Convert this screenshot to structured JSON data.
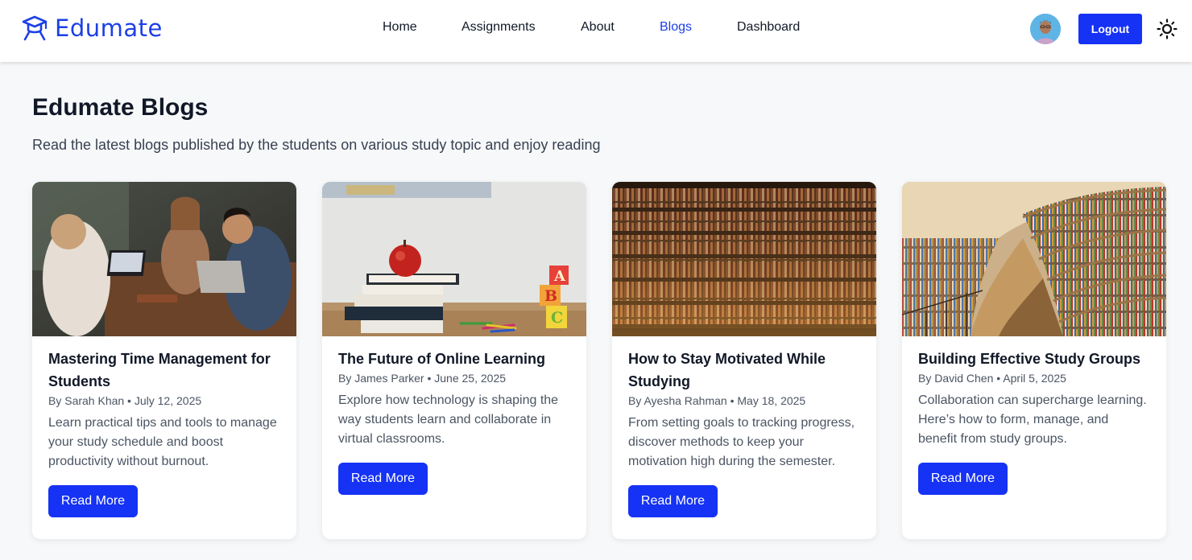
{
  "brand": {
    "name": "Edumate",
    "color": "#1d3fe6"
  },
  "nav": {
    "items": [
      {
        "label": "Home",
        "active": false
      },
      {
        "label": "Assignments",
        "active": false
      },
      {
        "label": "About",
        "active": false
      },
      {
        "label": "Blogs",
        "active": true
      },
      {
        "label": "Dashboard",
        "active": false
      }
    ]
  },
  "header": {
    "logout_label": "Logout",
    "avatar_icon": "user-avatar",
    "theme_icon": "sun-icon"
  },
  "page": {
    "title": "Edumate Blogs",
    "subtitle": "Read the latest blogs published by the students on various study topic and enjoy reading"
  },
  "blogs": [
    {
      "title": "Mastering Time Management for Students",
      "meta": "By Sarah Khan • July 12, 2025",
      "description": "Learn practical tips and tools to manage your study schedule and boost productivity without burnout.",
      "button": "Read More",
      "image": "students-with-laptop"
    },
    {
      "title": "The Future of Online Learning",
      "meta": "By James Parker • June 25, 2025",
      "description": "Explore how technology is shaping the way students learn and collaborate in virtual classrooms.",
      "button": "Read More",
      "image": "apple-on-books"
    },
    {
      "title": "How to Stay Motivated While Studying",
      "meta": "By Ayesha Rahman • May 18, 2025",
      "description": "From setting goals to tracking progress, discover methods to keep your motivation high during the semester.",
      "button": "Read More",
      "image": "library-bookshelves"
    },
    {
      "title": "Building Effective Study Groups",
      "meta": "By David Chen • April 5, 2025",
      "description": "Collaboration can supercharge learning. Here’s how to form, manage, and benefit from study groups.",
      "button": "Read More",
      "image": "curved-library"
    }
  ],
  "colors": {
    "accent": "#1532f5",
    "background": "#f7f8fa"
  }
}
